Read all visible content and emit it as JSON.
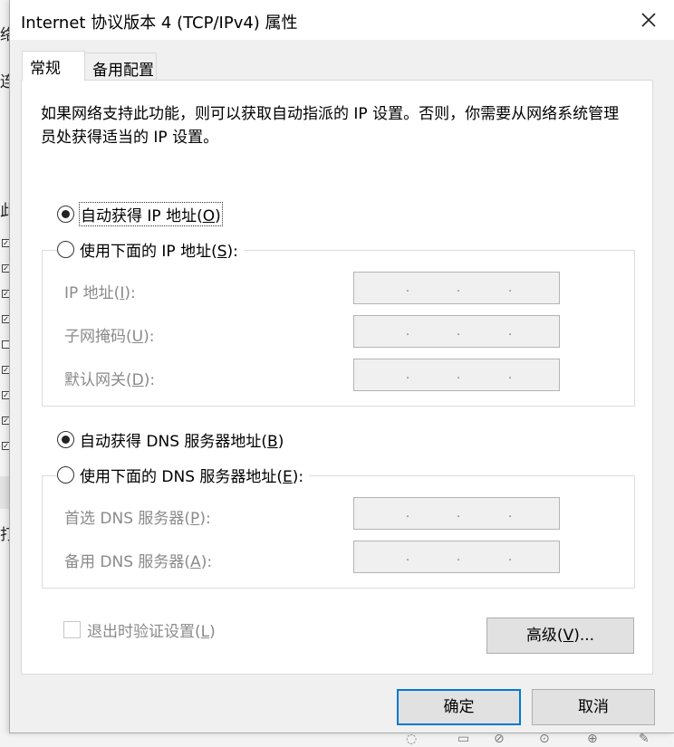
{
  "window": {
    "title": "Internet 协议版本 4 (TCP/IPv4) 属性"
  },
  "background": {
    "fragments": [
      "络",
      "连",
      "此",
      "打"
    ]
  },
  "tabs": [
    {
      "label": "常规"
    },
    {
      "label": "备用配置"
    }
  ],
  "description": "如果网络支持此功能，则可以获取自动指派的 IP 设置。否则，你需要从网络系统管理员处获得适当的 IP 设置。",
  "ip_section": {
    "auto_radio": {
      "label": "自动获得 IP 地址(",
      "key": "O",
      "suffix": ")",
      "checked": true
    },
    "manual_radio": {
      "label": "使用下面的 IP 地址(",
      "key": "S",
      "suffix": "):",
      "checked": false
    },
    "fields": [
      {
        "label": "IP 地址(",
        "key": "I",
        "suffix": "):",
        "value": ". . ."
      },
      {
        "label": "子网掩码(",
        "key": "U",
        "suffix": "):",
        "value": ". . ."
      },
      {
        "label": "默认网关(",
        "key": "D",
        "suffix": "):",
        "value": ". . ."
      }
    ]
  },
  "dns_section": {
    "auto_radio": {
      "label": "自动获得 DNS 服务器地址(",
      "key": "B",
      "suffix": ")",
      "checked": true
    },
    "manual_radio": {
      "label": "使用下面的 DNS 服务器地址(",
      "key": "E",
      "suffix": "):",
      "checked": false
    },
    "fields": [
      {
        "label": "首选 DNS 服务器(",
        "key": "P",
        "suffix": "):",
        "value": ". . ."
      },
      {
        "label": "备用 DNS 服务器(",
        "key": "A",
        "suffix": "):",
        "value": ". . ."
      }
    ]
  },
  "validate_checkbox": {
    "label": "退出时验证设置(",
    "key": "L",
    "suffix": ")",
    "checked": false
  },
  "buttons": {
    "advanced": {
      "label": "高级(",
      "key": "V",
      "suffix": ")..."
    },
    "ok": "确定",
    "cancel": "取消"
  },
  "colors": {
    "focus_border": "#0078d7",
    "disabled_text": "#8a8a8a"
  }
}
